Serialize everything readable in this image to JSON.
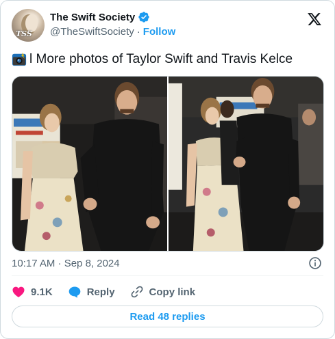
{
  "account": {
    "display_name": "The Swift Society",
    "handle": "@TheSwiftSociety",
    "separator": "·",
    "follow_label": "Follow",
    "avatar_monogram": "TSS",
    "verified": true
  },
  "tweet": {
    "emoji": "camera-with-flash-icon",
    "text": "l More photos of Taylor Swift and Travis Kelce",
    "photos": [
      {
        "alt": "photo-1",
        "signage": "Mercell Sinai Ga"
      },
      {
        "alt": "photo-2",
        "signage": "Sinai Ga"
      }
    ],
    "timestamp": "10:17 AM · Sep 8, 2024"
  },
  "actions": {
    "likes": "9.1K",
    "reply_label": "Reply",
    "copy_link_label": "Copy link"
  },
  "replies_button": "Read 48 replies",
  "colors": {
    "accent": "#1d9bf0",
    "like": "#f91880",
    "secondary_text": "#536471"
  }
}
